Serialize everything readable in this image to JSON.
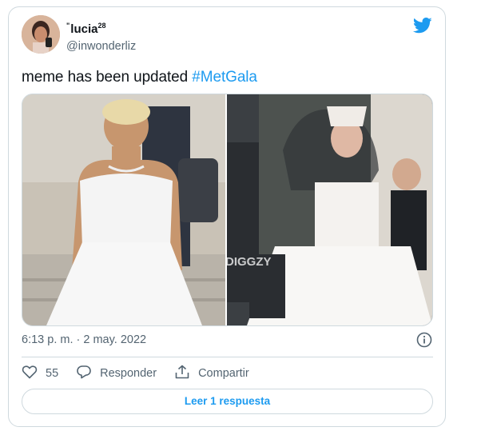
{
  "author": {
    "display_name": "lucia",
    "display_prefix": "\"",
    "display_sup": "28",
    "handle": "@inwonderliz"
  },
  "tweet": {
    "text": "meme has been updated ",
    "hashtag": "#MetGala"
  },
  "media": {
    "watermark": "DIGGZY",
    "photo_count": 2
  },
  "timestamp": "6:13 p. m. · 2 may. 2022",
  "actions": {
    "like_count": "55",
    "reply_label": "Responder",
    "share_label": "Compartir"
  },
  "read_replies_label": "Leer 1 respuesta",
  "colors": {
    "accent": "#1d9bf0",
    "muted": "#536471",
    "border": "#cfd9de"
  },
  "icons": [
    "twitter-bird-icon",
    "info-icon",
    "heart-icon",
    "reply-icon",
    "share-icon"
  ]
}
